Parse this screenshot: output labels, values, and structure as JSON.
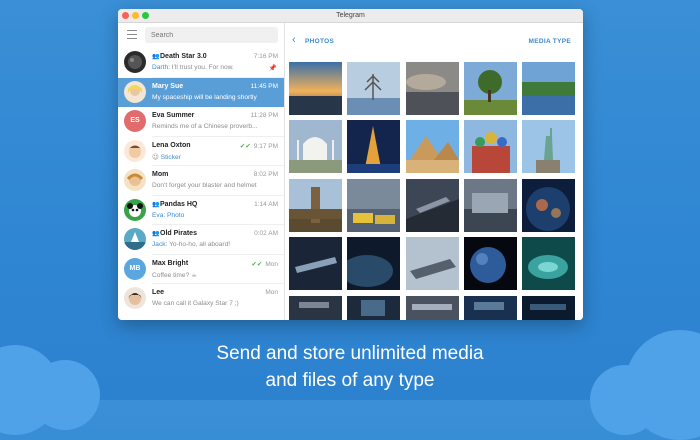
{
  "window": {
    "title": "Telegram"
  },
  "sidebar": {
    "search_placeholder": "Search",
    "chats": [
      {
        "name": "Death Star 3.0",
        "group": true,
        "sender": "Darth:",
        "message": " I'll trust you. For now.",
        "time": "7:16 PM",
        "pinned": true
      },
      {
        "name": "Mary Sue",
        "group": false,
        "sender": "",
        "message": "My spaceship will be landing shortly",
        "time": "11:45 PM",
        "active": true
      },
      {
        "name": "Eva Summer",
        "group": false,
        "sender": "",
        "message": "Reminds me of a Chinese proverb...",
        "time": "11:28 PM",
        "initials": "ES"
      },
      {
        "name": "Lena Oxton",
        "group": false,
        "sender": "",
        "message": "Sticker",
        "sticker": true,
        "time": "9:17 PM",
        "read": true
      },
      {
        "name": "Mom",
        "group": false,
        "sender": "",
        "message": "Don't forget your blaster and helmet",
        "time": "8:02 PM"
      },
      {
        "name": "Pandas HQ",
        "group": true,
        "sender": "Eva: Photo",
        "message": "",
        "time": "1:14 AM"
      },
      {
        "name": "Old Pirates",
        "group": true,
        "sender": "Jack:",
        "message": " Yo-ho-ho, all aboard!",
        "time": "0:02 AM"
      },
      {
        "name": "Max Bright",
        "group": false,
        "sender": "",
        "message": "Coffee time? ☕",
        "time": "Mon",
        "read": true,
        "initials": "MB"
      },
      {
        "name": "Lee",
        "group": false,
        "sender": "",
        "message": "We can call it Galaxy Star 7 ;)",
        "time": "Mon"
      }
    ]
  },
  "main": {
    "back_icon": "chevron-left-icon",
    "title": "PHOTOS",
    "media_type": "MEDIA TYPE"
  },
  "caption": {
    "line1": "Send and store unlimited media",
    "line2": "and files of any type"
  },
  "colors": {
    "accent": "#3a8ad2",
    "active_chat": "#5a9ed8",
    "background": "#2f86d2"
  }
}
